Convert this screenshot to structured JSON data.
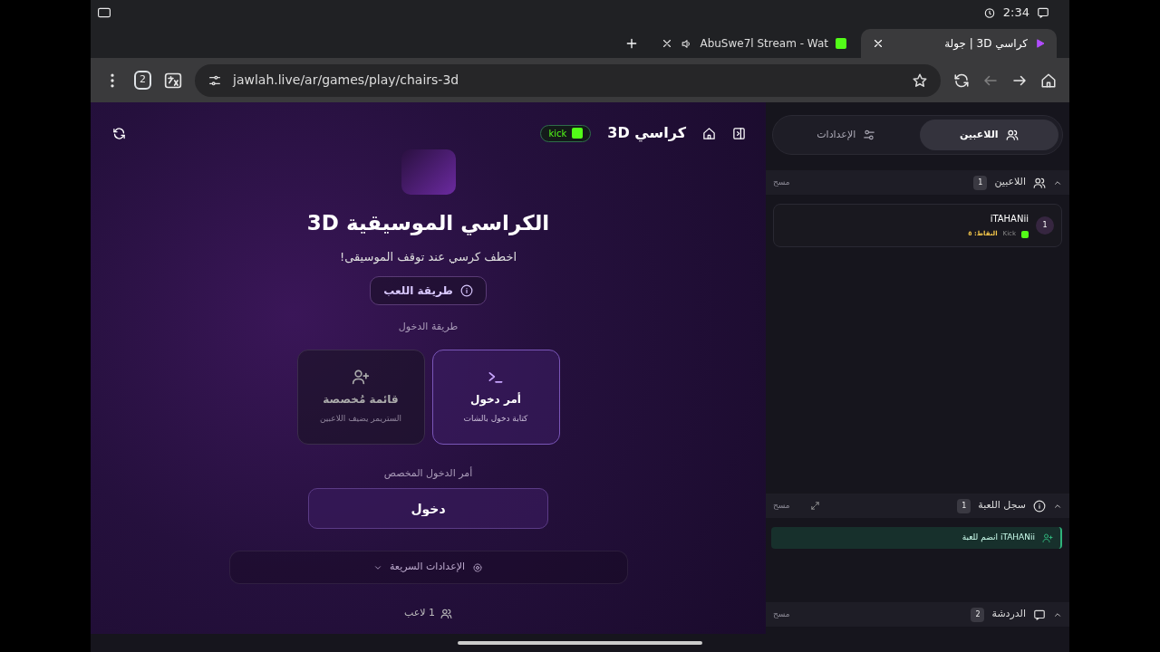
{
  "status_bar": {
    "time": "2:34"
  },
  "browser": {
    "tabs": [
      {
        "title": "كراسي 3D | جولة",
        "selected": true,
        "audio": false
      },
      {
        "title": "AbuSwe7l Stream - Wat",
        "selected": false,
        "audio": true
      }
    ],
    "tab_count": "2",
    "url": "jawlah.live/ar/games/play/chairs-3d"
  },
  "game": {
    "header": {
      "title": "كراسي 3D",
      "badge": "kick"
    },
    "heading": "الكراسي الموسيقية 3D",
    "subtitle": "اخطف كرسي عند توقف الموسيقى!",
    "how_to_button": "طريقة اللعب",
    "entry_label": "طريقة الدخول",
    "entry_methods": [
      {
        "kind": "command",
        "title": "أمر دخول",
        "description": "كتابة دخول بالشات",
        "selected": true
      },
      {
        "kind": "list",
        "title": "قائمة مُخصصة",
        "description": "الستريمر يضيف اللاعبين",
        "selected": false
      }
    ],
    "command_label": "أمر الدخول المخصص",
    "command_value": "دخول",
    "quick_settings": {
      "label": "الإعدادات السريعة",
      "expanded": false
    },
    "player_count": "1 لاعب"
  },
  "sidebar": {
    "tabs": [
      {
        "label": "اللاعبين",
        "selected": true
      },
      {
        "label": "الإعدادات",
        "selected": false
      }
    ],
    "players_section": {
      "title": "اللاعبين",
      "count": "1",
      "clear": "مسح",
      "expanded": true,
      "players": [
        {
          "rank": "1",
          "name": "iTAHANii",
          "platform": "Kick",
          "points": "النقاط: ٥"
        }
      ]
    },
    "log_section": {
      "title": "سجل اللعبة",
      "count": "1",
      "clear": "مسح",
      "expanded": true,
      "entries": [
        {
          "text": "iTAHANii انضم للعبة"
        }
      ]
    },
    "chat_section": {
      "title": "الدردشة",
      "count": "2",
      "clear": "مسح",
      "expanded": true
    }
  }
}
